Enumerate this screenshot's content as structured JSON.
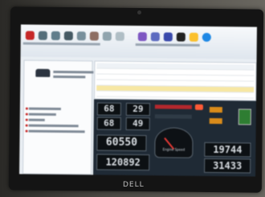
{
  "dashboard": {
    "lcd_1": "68",
    "lcd_2": "29",
    "lcd_3": "68",
    "lcd_4": "49",
    "odometer_1": "60550",
    "odometer_2": "120892",
    "gauge_title": "Engine Speed",
    "right_value_1": "19744",
    "right_value_2": "31433"
  },
  "screen": {
    "brand_logo": "DELL"
  },
  "colors": {
    "accent_red": "#b3282d",
    "accent_orange": "#d98b1a",
    "dash_background": "#1f2a35"
  }
}
